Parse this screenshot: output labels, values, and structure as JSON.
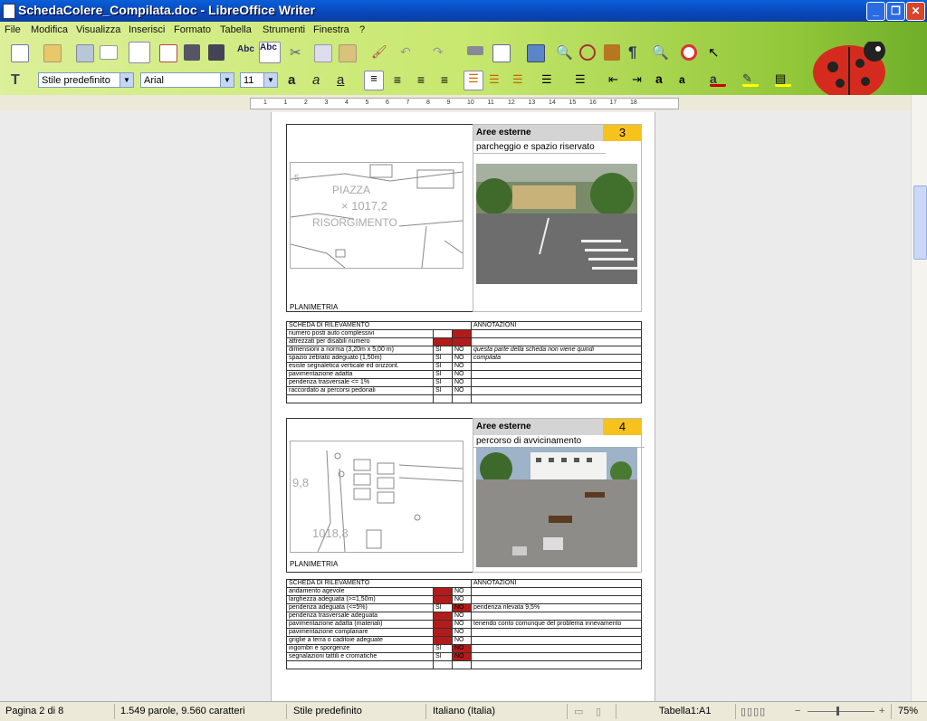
{
  "window": {
    "title": "SchedaColere_Compilata.doc - LibreOffice Writer",
    "min": "_",
    "max": "❐",
    "close": "✕"
  },
  "menu": [
    "File",
    "Modifica",
    "Visualizza",
    "Inserisci",
    "Formato",
    "Tabella",
    "Strumenti",
    "Finestra",
    "?"
  ],
  "formatting": {
    "style": "Stile predefinito",
    "font": "Arial",
    "size": "11"
  },
  "ruler": {
    "ticks": [
      "1",
      "1",
      "2",
      "3",
      "4",
      "5",
      "6",
      "7",
      "8",
      "9",
      "10",
      "11",
      "12",
      "13",
      "14",
      "15",
      "16",
      "17",
      "18"
    ]
  },
  "doc": {
    "s3": {
      "header": "Aree esterne",
      "number": "3",
      "subtitle": "parcheggio e spazio riservato",
      "plan_label": "PLANIMETRIA",
      "map_text": [
        "5",
        "PIAZZA",
        "× 1017,2",
        "RISORGIMENTO"
      ]
    },
    "t3": {
      "title": "SCHEDA DI RILEVAMENTO",
      "annot": "ANNOTAZIONI",
      "rows": [
        {
          "label": "numero posti auto complessivi",
          "si": "",
          "no": "",
          "si_red": false,
          "no_red": true,
          "note": ""
        },
        {
          "label": "attrezzati per disabili numero",
          "si": "",
          "no": "",
          "si_red": true,
          "no_red": true,
          "note": ""
        },
        {
          "label": "dimensioni a norma (3,20m x 5,00 m)",
          "si": "SI",
          "no": "NO",
          "si_red": false,
          "no_red": false,
          "note": "questa parte della scheda non viene quindi"
        },
        {
          "label": "spazio zebrato adeguato (1,50m)",
          "si": "SI",
          "no": "NO",
          "si_red": false,
          "no_red": false,
          "note": "compilata"
        },
        {
          "label": "esiste segnaletica verticale ed orizzont.",
          "si": "SI",
          "no": "NO",
          "si_red": false,
          "no_red": false,
          "note": ""
        },
        {
          "label": "pavimentazione adatta",
          "si": "SI",
          "no": "NO",
          "si_red": false,
          "no_red": false,
          "note": ""
        },
        {
          "label": "pendenza trasversale <= 1%",
          "si": "SI",
          "no": "NO",
          "si_red": false,
          "no_red": false,
          "note": ""
        },
        {
          "label": "raccordato ai percorsi pedonali",
          "si": "SI",
          "no": "NO",
          "si_red": false,
          "no_red": false,
          "note": ""
        }
      ]
    },
    "s4": {
      "header": "Aree esterne",
      "number": "4",
      "subtitle": "percorso di avvicinamento",
      "plan_label": "PLANIMETRIA",
      "map_text": [
        "9,8",
        "1018,8"
      ]
    },
    "t4": {
      "title": "SCHEDA DI RILEVAMENTO",
      "annot": "ANNOTAZIONI",
      "rows": [
        {
          "label": "andamento agevole",
          "si": "",
          "no": "NO",
          "si_red": true,
          "no_red": false,
          "note": ""
        },
        {
          "label": "larghezza adeguata (>=1,50m)",
          "si": "",
          "no": "NO",
          "si_red": true,
          "no_red": false,
          "note": ""
        },
        {
          "label": "pendenza adeguata (<=5%)",
          "si": "SI",
          "no": "NO",
          "si_red": false,
          "no_red": true,
          "note": "pendenza rilevata 9,5%"
        },
        {
          "label": "pendenza trasversale adeguata",
          "si": "",
          "no": "NO",
          "si_red": true,
          "no_red": false,
          "note": ""
        },
        {
          "label": "pavimentazione adatta (materiali)",
          "si": "",
          "no": "NO",
          "si_red": true,
          "no_red": false,
          "note": "tenendo conto comunque del problema innevamento"
        },
        {
          "label": "pavimentazione complanare",
          "si": "",
          "no": "NO",
          "si_red": true,
          "no_red": false,
          "note": ""
        },
        {
          "label": "griglie a terra o caditoie adeguate",
          "si": "",
          "no": "NO",
          "si_red": true,
          "no_red": false,
          "note": ""
        },
        {
          "label": "ingombri e sporgenze",
          "si": "SI",
          "no": "NO",
          "si_red": false,
          "no_red": true,
          "note": ""
        },
        {
          "label": "segnalazioni tattili e cromatiche",
          "si": "SI",
          "no": "NO",
          "si_red": false,
          "no_red": true,
          "note": ""
        }
      ]
    }
  },
  "status": {
    "page": "Pagina 2 di 8",
    "words": "1.549 parole, 9.560 caratteri",
    "style": "Stile predefinito",
    "lang": "Italiano (Italia)",
    "cell": "Tabella1:A1",
    "zoom": "75%"
  },
  "colors": {
    "accent": "#f7c21b",
    "mark": "#b31b1b",
    "header": "#d4d4d4"
  }
}
